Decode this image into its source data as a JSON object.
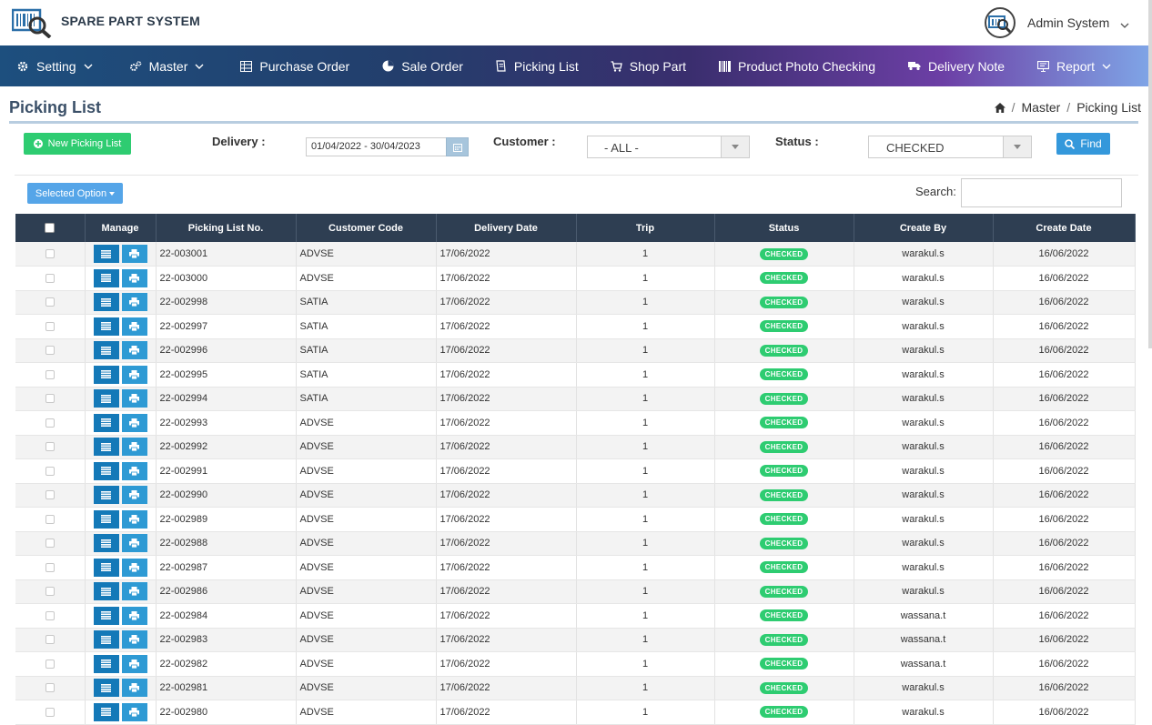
{
  "app": {
    "brand": "SPARE PART SYSTEM",
    "user_name": "Admin System"
  },
  "nav": [
    {
      "label": "Setting",
      "icon": "gear-icon",
      "dropdown": true
    },
    {
      "label": "Master",
      "icon": "gears-icon",
      "dropdown": true
    },
    {
      "label": "Purchase Order",
      "icon": "table-icon",
      "dropdown": false
    },
    {
      "label": "Sale Order",
      "icon": "pie-chart-icon",
      "dropdown": false
    },
    {
      "label": "Picking List",
      "icon": "document-icon",
      "dropdown": false
    },
    {
      "label": "Shop Part",
      "icon": "cart-icon",
      "dropdown": false
    },
    {
      "label": "Product Photo Checking",
      "icon": "barcode-icon",
      "dropdown": false
    },
    {
      "label": "Delivery Note",
      "icon": "truck-icon",
      "dropdown": false
    },
    {
      "label": "Report",
      "icon": "monitor-icon",
      "dropdown": true
    }
  ],
  "page": {
    "title": "Picking List"
  },
  "breadcrumb": {
    "item1": "Master",
    "sep": "/",
    "item2": "Picking List"
  },
  "filters": {
    "new_button": "New Picking List",
    "delivery_label": "Delivery :",
    "delivery_value": "01/04/2022 - 30/04/2023",
    "customer_label": "Customer :",
    "customer_value": "- ALL -",
    "status_label": "Status :",
    "status_value": "CHECKED",
    "find_button": "Find",
    "option_button": "Selected Option",
    "search_label": "Search:"
  },
  "table": {
    "headers": [
      "",
      "Manage",
      "Picking List No.",
      "Customer Code",
      "Delivery Date",
      "Trip",
      "Status",
      "Create By",
      "Create Date"
    ],
    "rows": [
      [
        "22-003001",
        "ADVSE",
        "17/06/2022",
        "1",
        "CHECKED",
        "warakul.s",
        "16/06/2022"
      ],
      [
        "22-003000",
        "ADVSE",
        "17/06/2022",
        "1",
        "CHECKED",
        "warakul.s",
        "16/06/2022"
      ],
      [
        "22-002998",
        "SATIA",
        "17/06/2022",
        "1",
        "CHECKED",
        "warakul.s",
        "16/06/2022"
      ],
      [
        "22-002997",
        "SATIA",
        "17/06/2022",
        "1",
        "CHECKED",
        "warakul.s",
        "16/06/2022"
      ],
      [
        "22-002996",
        "SATIA",
        "17/06/2022",
        "1",
        "CHECKED",
        "warakul.s",
        "16/06/2022"
      ],
      [
        "22-002995",
        "SATIA",
        "17/06/2022",
        "1",
        "CHECKED",
        "warakul.s",
        "16/06/2022"
      ],
      [
        "22-002994",
        "SATIA",
        "17/06/2022",
        "1",
        "CHECKED",
        "warakul.s",
        "16/06/2022"
      ],
      [
        "22-002993",
        "ADVSE",
        "17/06/2022",
        "1",
        "CHECKED",
        "warakul.s",
        "16/06/2022"
      ],
      [
        "22-002992",
        "ADVSE",
        "17/06/2022",
        "1",
        "CHECKED",
        "warakul.s",
        "16/06/2022"
      ],
      [
        "22-002991",
        "ADVSE",
        "17/06/2022",
        "1",
        "CHECKED",
        "warakul.s",
        "16/06/2022"
      ],
      [
        "22-002990",
        "ADVSE",
        "17/06/2022",
        "1",
        "CHECKED",
        "warakul.s",
        "16/06/2022"
      ],
      [
        "22-002989",
        "ADVSE",
        "17/06/2022",
        "1",
        "CHECKED",
        "warakul.s",
        "16/06/2022"
      ],
      [
        "22-002988",
        "ADVSE",
        "17/06/2022",
        "1",
        "CHECKED",
        "warakul.s",
        "16/06/2022"
      ],
      [
        "22-002987",
        "ADVSE",
        "17/06/2022",
        "1",
        "CHECKED",
        "warakul.s",
        "16/06/2022"
      ],
      [
        "22-002986",
        "ADVSE",
        "17/06/2022",
        "1",
        "CHECKED",
        "warakul.s",
        "16/06/2022"
      ],
      [
        "22-002984",
        "ADVSE",
        "17/06/2022",
        "1",
        "CHECKED",
        "wassana.t",
        "16/06/2022"
      ],
      [
        "22-002983",
        "ADVSE",
        "17/06/2022",
        "1",
        "CHECKED",
        "wassana.t",
        "16/06/2022"
      ],
      [
        "22-002982",
        "ADVSE",
        "17/06/2022",
        "1",
        "CHECKED",
        "wassana.t",
        "16/06/2022"
      ],
      [
        "22-002981",
        "ADVSE",
        "17/06/2022",
        "1",
        "CHECKED",
        "warakul.s",
        "16/06/2022"
      ],
      [
        "22-002980",
        "ADVSE",
        "17/06/2022",
        "1",
        "CHECKED",
        "warakul.s",
        "16/06/2022"
      ]
    ]
  },
  "colors": {
    "nav_start": "#1d4f7e",
    "nav_end": "#7fa4e6",
    "table_header": "#2e3e52",
    "status_badge": "#2ecc71",
    "manage_button": "#1479b8",
    "find_button": "#3498db",
    "new_button": "#2ecc71"
  }
}
